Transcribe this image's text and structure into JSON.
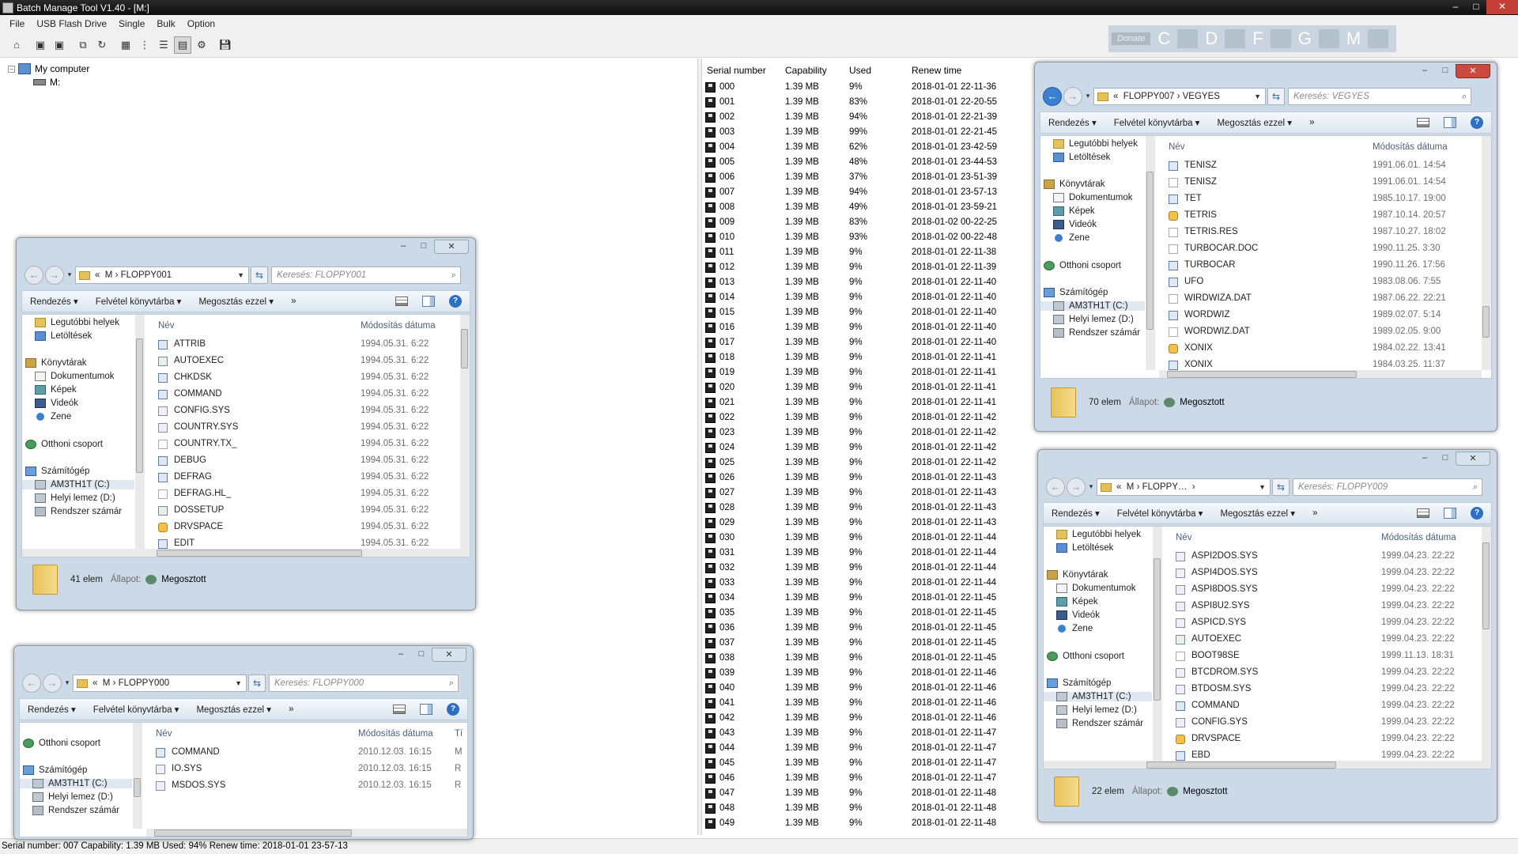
{
  "app": {
    "title": "Batch Manage Tool V1.40 - [M:]",
    "menu": [
      "File",
      "USB Flash Drive",
      "Single",
      "Bulk",
      "Option"
    ],
    "window_controls": {
      "minimize": "–",
      "maximize": "□",
      "close": "✕"
    }
  },
  "drivebar": {
    "donate": "Donate",
    "letters": [
      "C",
      "D",
      "F",
      "G",
      "M"
    ]
  },
  "tree": {
    "root": "My computer",
    "drive": "M:"
  },
  "disklist": {
    "columns": [
      "Serial number",
      "Capability",
      "Used",
      "Renew time"
    ],
    "rows": [
      [
        "000",
        "1.39 MB",
        "9%",
        "2018-01-01 22-11-36"
      ],
      [
        "001",
        "1.39 MB",
        "83%",
        "2018-01-01 22-20-55"
      ],
      [
        "002",
        "1.39 MB",
        "94%",
        "2018-01-01 22-21-39"
      ],
      [
        "003",
        "1.39 MB",
        "99%",
        "2018-01-01 22-21-45"
      ],
      [
        "004",
        "1.39 MB",
        "62%",
        "2018-01-01 23-42-59"
      ],
      [
        "005",
        "1.39 MB",
        "48%",
        "2018-01-01 23-44-53"
      ],
      [
        "006",
        "1.39 MB",
        "37%",
        "2018-01-01 23-51-39"
      ],
      [
        "007",
        "1.39 MB",
        "94%",
        "2018-01-01 23-57-13"
      ],
      [
        "008",
        "1.39 MB",
        "49%",
        "2018-01-01 23-59-21"
      ],
      [
        "009",
        "1.39 MB",
        "83%",
        "2018-01-02 00-22-25"
      ],
      [
        "010",
        "1.39 MB",
        "93%",
        "2018-01-02 00-22-48"
      ],
      [
        "011",
        "1.39 MB",
        "9%",
        "2018-01-01 22-11-38"
      ],
      [
        "012",
        "1.39 MB",
        "9%",
        "2018-01-01 22-11-39"
      ],
      [
        "013",
        "1.39 MB",
        "9%",
        "2018-01-01 22-11-40"
      ],
      [
        "014",
        "1.39 MB",
        "9%",
        "2018-01-01 22-11-40"
      ],
      [
        "015",
        "1.39 MB",
        "9%",
        "2018-01-01 22-11-40"
      ],
      [
        "016",
        "1.39 MB",
        "9%",
        "2018-01-01 22-11-40"
      ],
      [
        "017",
        "1.39 MB",
        "9%",
        "2018-01-01 22-11-40"
      ],
      [
        "018",
        "1.39 MB",
        "9%",
        "2018-01-01 22-11-41"
      ],
      [
        "019",
        "1.39 MB",
        "9%",
        "2018-01-01 22-11-41"
      ],
      [
        "020",
        "1.39 MB",
        "9%",
        "2018-01-01 22-11-41"
      ],
      [
        "021",
        "1.39 MB",
        "9%",
        "2018-01-01 22-11-41"
      ],
      [
        "022",
        "1.39 MB",
        "9%",
        "2018-01-01 22-11-42"
      ],
      [
        "023",
        "1.39 MB",
        "9%",
        "2018-01-01 22-11-42"
      ],
      [
        "024",
        "1.39 MB",
        "9%",
        "2018-01-01 22-11-42"
      ],
      [
        "025",
        "1.39 MB",
        "9%",
        "2018-01-01 22-11-42"
      ],
      [
        "026",
        "1.39 MB",
        "9%",
        "2018-01-01 22-11-43"
      ],
      [
        "027",
        "1.39 MB",
        "9%",
        "2018-01-01 22-11-43"
      ],
      [
        "028",
        "1.39 MB",
        "9%",
        "2018-01-01 22-11-43"
      ],
      [
        "029",
        "1.39 MB",
        "9%",
        "2018-01-01 22-11-43"
      ],
      [
        "030",
        "1.39 MB",
        "9%",
        "2018-01-01 22-11-44"
      ],
      [
        "031",
        "1.39 MB",
        "9%",
        "2018-01-01 22-11-44"
      ],
      [
        "032",
        "1.39 MB",
        "9%",
        "2018-01-01 22-11-44"
      ],
      [
        "033",
        "1.39 MB",
        "9%",
        "2018-01-01 22-11-44"
      ],
      [
        "034",
        "1.39 MB",
        "9%",
        "2018-01-01 22-11-45"
      ],
      [
        "035",
        "1.39 MB",
        "9%",
        "2018-01-01 22-11-45"
      ],
      [
        "036",
        "1.39 MB",
        "9%",
        "2018-01-01 22-11-45"
      ],
      [
        "037",
        "1.39 MB",
        "9%",
        "2018-01-01 22-11-45"
      ],
      [
        "038",
        "1.39 MB",
        "9%",
        "2018-01-01 22-11-45"
      ],
      [
        "039",
        "1.39 MB",
        "9%",
        "2018-01-01 22-11-46"
      ],
      [
        "040",
        "1.39 MB",
        "9%",
        "2018-01-01 22-11-46"
      ],
      [
        "041",
        "1.39 MB",
        "9%",
        "2018-01-01 22-11-46"
      ],
      [
        "042",
        "1.39 MB",
        "9%",
        "2018-01-01 22-11-46"
      ],
      [
        "043",
        "1.39 MB",
        "9%",
        "2018-01-01 22-11-47"
      ],
      [
        "044",
        "1.39 MB",
        "9%",
        "2018-01-01 22-11-47"
      ],
      [
        "045",
        "1.39 MB",
        "9%",
        "2018-01-01 22-11-47"
      ],
      [
        "046",
        "1.39 MB",
        "9%",
        "2018-01-01 22-11-47"
      ],
      [
        "047",
        "1.39 MB",
        "9%",
        "2018-01-01 22-11-48"
      ],
      [
        "048",
        "1.39 MB",
        "9%",
        "2018-01-01 22-11-48"
      ],
      [
        "049",
        "1.39 MB",
        "9%",
        "2018-01-01 22-11-48"
      ]
    ]
  },
  "status": "Serial number: 007 Capability: 1.39 MB  Used: 94%  Renew time: 2018-01-01 23-57-13",
  "explorer": {
    "toolbar": {
      "organize": "Rendezés",
      "library": "Felvétel könyvtárba",
      "share": "Megosztás ezzel",
      "more": "»"
    },
    "columns": {
      "name": "Név",
      "modified": "Módosítás dátuma",
      "type_trunc": "Tí"
    },
    "status_label": "Állapot:",
    "shared": "Megosztott",
    "nav": {
      "recent": "Legutóbbi helyek",
      "downloads": "Letöltések",
      "libraries": "Könyvtárak",
      "documents": "Dokumentumok",
      "pictures": "Képek",
      "videos": "Videók",
      "music": "Zene",
      "homegroup": "Otthoni csoport",
      "computer": "Számítógép",
      "drive_c": "AM3TH1T (C:)",
      "drive_d": "Helyi lemez (D:)",
      "system": "Rendszer számár"
    }
  },
  "windows": {
    "vegyes": {
      "path": [
        "«",
        "FLOPPY007",
        "›",
        "VEGYES"
      ],
      "search": "Keresés: VEGYES",
      "count": "70 elem",
      "files": [
        {
          "name": "TENISZ",
          "date": "1991.06.01. 14:54",
          "icon": "exe"
        },
        {
          "name": "TENISZ",
          "date": "1991.06.01. 14:54",
          "icon": "txt"
        },
        {
          "name": "TET",
          "date": "1985.10.17. 19:00",
          "icon": "exe"
        },
        {
          "name": "TETRIS",
          "date": "1987.10.14. 20:57",
          "icon": "star"
        },
        {
          "name": "TETRIS.RES",
          "date": "1987.10.27. 18:02",
          "icon": "txt"
        },
        {
          "name": "TURBOCAR.DOC",
          "date": "1990.11.25. 3:30",
          "icon": "txt"
        },
        {
          "name": "TURBOCAR",
          "date": "1990.11.26. 17:56",
          "icon": "exe"
        },
        {
          "name": "UFO",
          "date": "1983.08.06. 7:55",
          "icon": "exe"
        },
        {
          "name": "WIRDWIZA.DAT",
          "date": "1987.06.22. 22:21",
          "icon": "txt"
        },
        {
          "name": "WORDWIZ",
          "date": "1989.02.07. 5:14",
          "icon": "exe"
        },
        {
          "name": "WORDWIZ.DAT",
          "date": "1989.02.05. 9:00",
          "icon": "txt"
        },
        {
          "name": "XONIX",
          "date": "1984.02.22. 13:41",
          "icon": "star"
        },
        {
          "name": "XONIX",
          "date": "1984.03.25. 11:37",
          "icon": "exe"
        }
      ]
    },
    "floppy001": {
      "path": [
        "«",
        "M",
        "›",
        "FLOPPY001"
      ],
      "search": "Keresés: FLOPPY001",
      "count": "41 elem",
      "files": [
        {
          "name": "ATTRIB",
          "date": "1994.05.31. 6:22",
          "icon": "exe"
        },
        {
          "name": "AUTOEXEC",
          "date": "1994.05.31. 6:22",
          "icon": "bat"
        },
        {
          "name": "CHKDSK",
          "date": "1994.05.31. 6:22",
          "icon": "exe"
        },
        {
          "name": "COMMAND",
          "date": "1994.05.31. 6:22",
          "icon": "exe"
        },
        {
          "name": "CONFIG.SYS",
          "date": "1994.05.31. 6:22",
          "icon": "sys"
        },
        {
          "name": "COUNTRY.SYS",
          "date": "1994.05.31. 6:22",
          "icon": "sys"
        },
        {
          "name": "COUNTRY.TX_",
          "date": "1994.05.31. 6:22",
          "icon": "txt"
        },
        {
          "name": "DEBUG",
          "date": "1994.05.31. 6:22",
          "icon": "exe"
        },
        {
          "name": "DEFRAG",
          "date": "1994.05.31. 6:22",
          "icon": "exe"
        },
        {
          "name": "DEFRAG.HL_",
          "date": "1994.05.31. 6:22",
          "icon": "txt"
        },
        {
          "name": "DOSSETUP",
          "date": "1994.05.31. 6:22",
          "icon": "bat"
        },
        {
          "name": "DRVSPACE",
          "date": "1994.05.31. 6:22",
          "icon": "star"
        },
        {
          "name": "EDIT",
          "date": "1994.05.31. 6:22",
          "icon": "exe"
        }
      ]
    },
    "floppy000": {
      "path": [
        "«",
        "M",
        "›",
        "FLOPPY000"
      ],
      "search": "Keresés: FLOPPY000",
      "files": [
        {
          "name": "COMMAND",
          "date": "2010.12.03. 16:15",
          "type": "M",
          "icon": "exe"
        },
        {
          "name": "IO.SYS",
          "date": "2010.12.03. 16:15",
          "type": "R",
          "icon": "sys"
        },
        {
          "name": "MSDOS.SYS",
          "date": "2010.12.03. 16:15",
          "type": "R",
          "icon": "sys"
        }
      ]
    },
    "floppy009": {
      "path": [
        "«",
        "M",
        "›",
        "FLOPPY…",
        "›"
      ],
      "search": "Keresés: FLOPPY009",
      "count": "22 elem",
      "files": [
        {
          "name": "ASPI2DOS.SYS",
          "date": "1999.04.23. 22:22",
          "icon": "sys"
        },
        {
          "name": "ASPI4DOS.SYS",
          "date": "1999.04.23. 22:22",
          "icon": "sys"
        },
        {
          "name": "ASPI8DOS.SYS",
          "date": "1999.04.23. 22:22",
          "icon": "sys"
        },
        {
          "name": "ASPI8U2.SYS",
          "date": "1999.04.23. 22:22",
          "icon": "sys"
        },
        {
          "name": "ASPICD.SYS",
          "date": "1999.04.23. 22:22",
          "icon": "sys"
        },
        {
          "name": "AUTOEXEC",
          "date": "1999.04.23. 22:22",
          "icon": "bat"
        },
        {
          "name": "BOOT98SE",
          "date": "1999.11.13. 18:31",
          "icon": "txt"
        },
        {
          "name": "BTCDROM.SYS",
          "date": "1999.04.23. 22:22",
          "icon": "sys"
        },
        {
          "name": "BTDOSM.SYS",
          "date": "1999.04.23. 22:22",
          "icon": "sys"
        },
        {
          "name": "COMMAND",
          "date": "1999.04.23. 22:22",
          "icon": "exe"
        },
        {
          "name": "CONFIG.SYS",
          "date": "1999.04.23. 22:22",
          "icon": "sys"
        },
        {
          "name": "DRVSPACE",
          "date": "1999.04.23. 22:22",
          "icon": "star"
        },
        {
          "name": "EBD",
          "date": "1999.04.23. 22:22",
          "icon": "exe"
        }
      ]
    }
  }
}
